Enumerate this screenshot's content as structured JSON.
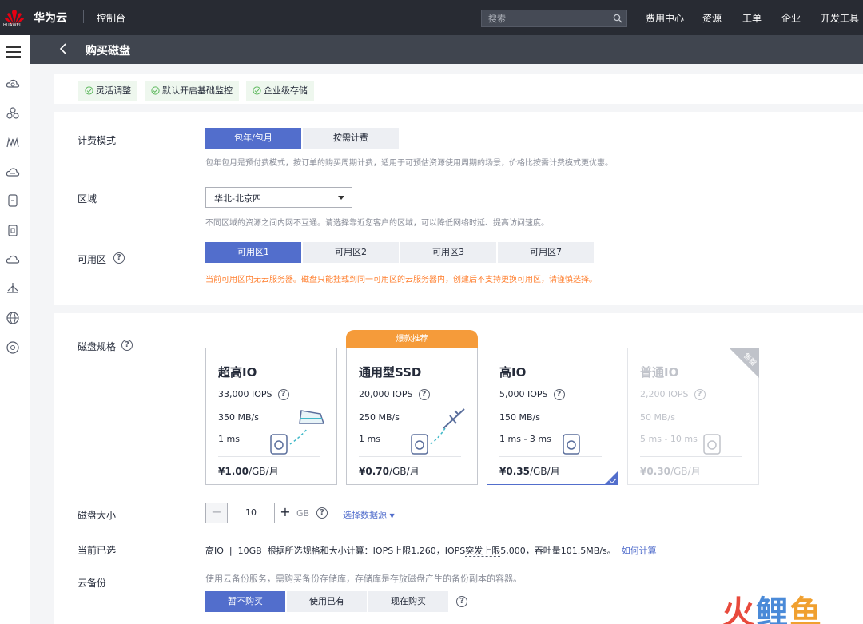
{
  "topbar": {
    "logo_text": "HUAWEI",
    "brand": "华为云",
    "console": "控制台",
    "search_placeholder": "搜索",
    "nav": [
      "费用中心",
      "资源",
      "工单",
      "企业",
      "开发工具"
    ]
  },
  "sidebar": {
    "icons": [
      "cloud-icon",
      "cluster-icon",
      "brand-icon",
      "cloud-disk-icon",
      "storage-icon",
      "files-icon",
      "cloud-outline-icon",
      "network-icon",
      "globe-icon",
      "settings-icon"
    ]
  },
  "header": {
    "title": "购买磁盘"
  },
  "features": [
    "灵活调整",
    "默认开启基础监控",
    "企业级存储"
  ],
  "billing": {
    "label": "计费模式",
    "options": [
      "包年/包月",
      "按需计费"
    ],
    "selected": "包年/包月",
    "hint": "包年包月是预付费模式，按订单的购买周期计费，适用于可预估资源使用周期的场景，价格比按需计费模式更优惠。"
  },
  "region": {
    "label": "区域",
    "value": "华北-北京四",
    "hint": "不同区域的资源之间内网不互通。请选择靠近您客户的区域，可以降低网络时延、提高访问速度。"
  },
  "az": {
    "label": "可用区",
    "options": [
      "可用区1",
      "可用区2",
      "可用区3",
      "可用区7"
    ],
    "selected": "可用区1",
    "warning": "当前可用区内无云服务器。磁盘只能挂载到同一可用区的云服务器内，创建后不支持更换可用区，请谨慎选择。"
  },
  "disk_spec": {
    "label": "磁盘规格",
    "hot_tag": "爆款推荐",
    "sold_out_tag": "售罄",
    "cards": [
      {
        "name": "超高IO",
        "iops": "33,000 IOPS",
        "throughput": "350 MB/s",
        "latency": "1 ms",
        "price": "¥1.00",
        "unit": "/GB/月"
      },
      {
        "name": "通用型SSD",
        "iops": "20,000 IOPS",
        "throughput": "250 MB/s",
        "latency": "1 ms",
        "price": "¥0.70",
        "unit": "/GB/月"
      },
      {
        "name": "高IO",
        "iops": "5,000 IOPS",
        "throughput": "150 MB/s",
        "latency": "1 ms - 3 ms",
        "price": "¥0.35",
        "unit": "/GB/月"
      },
      {
        "name": "普通IO",
        "iops": "2,200 IOPS",
        "throughput": "50 MB/s",
        "latency": "5 ms - 10 ms",
        "price": "¥0.30",
        "unit": "/GB/月"
      }
    ]
  },
  "disk_size": {
    "label": "磁盘大小",
    "value": "10",
    "unit": "GB",
    "source_link": "选择数据源"
  },
  "current": {
    "label": "当前已选",
    "type": "高IO",
    "size": "10GB",
    "text_a": "根据所选规格和大小计算：IOPS上限1,260，IOPS",
    "text_b": "突发上限",
    "text_c": "5,000，吞吐量101.5MB/s。",
    "link": "如何计算"
  },
  "backup": {
    "label": "云备份",
    "hint": "使用云备份服务，需购买备份存储库，存储库是存放磁盘产生的备份副本的容器。",
    "options": [
      "暂不购买",
      "使用已有",
      "现在购买"
    ],
    "selected": "暂不购买"
  },
  "watermark": {
    "chars": [
      "火",
      "鲤",
      "鱼"
    ],
    "colors": [
      "#e84a3c",
      "#4a8ad8",
      "#f0a030"
    ]
  }
}
